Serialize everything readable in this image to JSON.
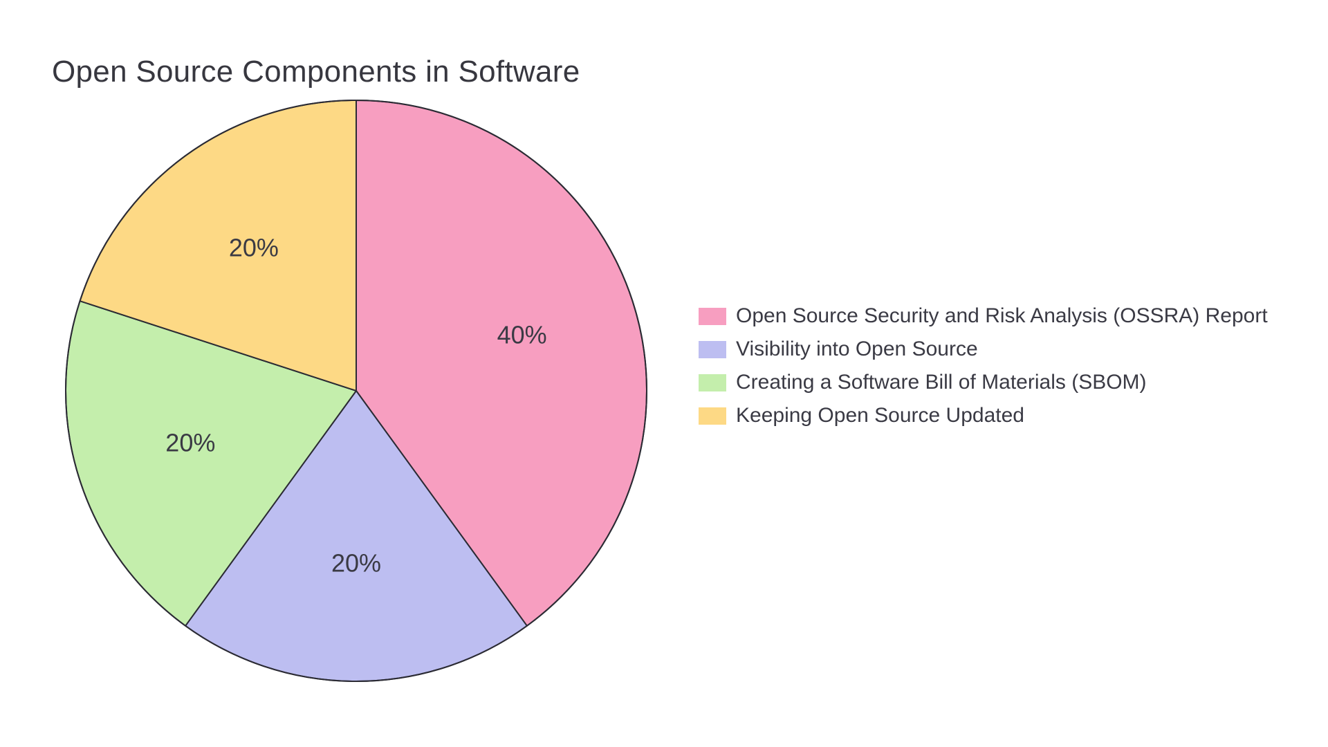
{
  "chart_data": {
    "type": "pie",
    "title": "Open Source Components in Software",
    "series": [
      {
        "name": "Open Source Security and Risk Analysis (OSSRA) Report",
        "value": 40,
        "label": "40%",
        "color": "#f79ec0"
      },
      {
        "name": "Visibility into Open Source",
        "value": 20,
        "label": "20%",
        "color": "#bdbef1"
      },
      {
        "name": "Creating a Software Bill of Materials (SBOM)",
        "value": 20,
        "label": "20%",
        "color": "#c4eeac"
      },
      {
        "name": "Keeping Open Source Updated",
        "value": 20,
        "label": "20%",
        "color": "#fdd985"
      }
    ],
    "outline": "#2b2b34"
  }
}
